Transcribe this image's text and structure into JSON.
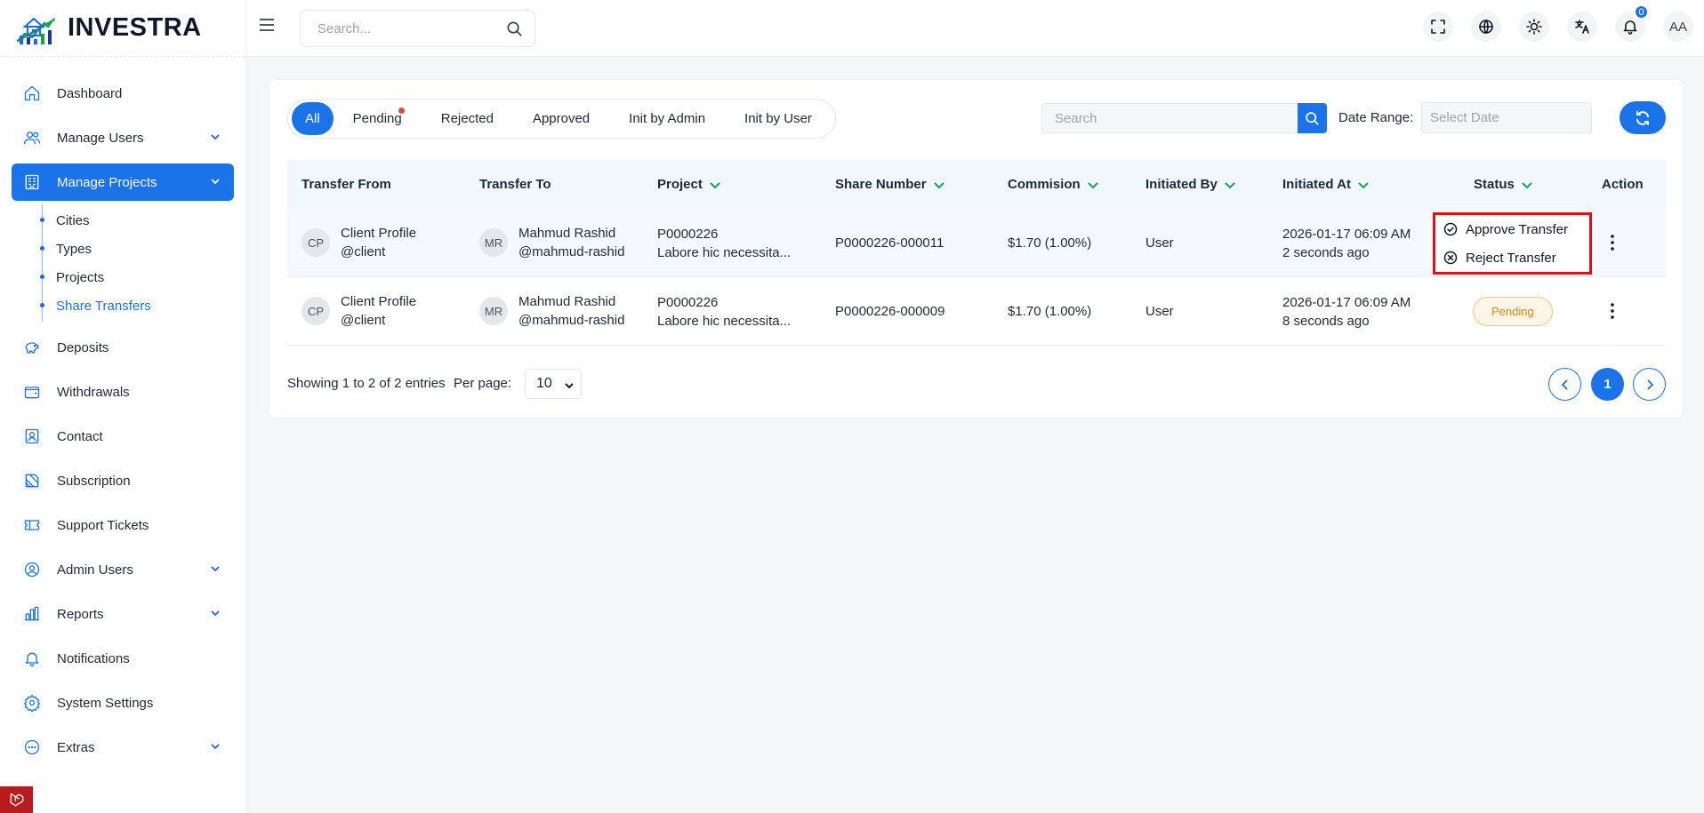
{
  "brand": {
    "name": "INVESTRA"
  },
  "topbar": {
    "search_placeholder": "Search...",
    "notification_count": "0",
    "avatar_initials": "AA"
  },
  "sidebar": {
    "items": [
      {
        "label": "Dashboard",
        "icon": "home-icon"
      },
      {
        "label": "Manage Users",
        "icon": "users-icon",
        "expandable": true
      },
      {
        "label": "Manage Projects",
        "icon": "building-icon",
        "expandable": true,
        "active": true,
        "children": [
          "Cities",
          "Types",
          "Projects",
          "Share Transfers"
        ],
        "active_child": "Share Transfers"
      },
      {
        "label": "Deposits",
        "icon": "piggy-bank-icon"
      },
      {
        "label": "Withdrawals",
        "icon": "wallet-icon"
      },
      {
        "label": "Contact",
        "icon": "contact-icon"
      },
      {
        "label": "Subscription",
        "icon": "subscription-icon"
      },
      {
        "label": "Support Tickets",
        "icon": "ticket-icon"
      },
      {
        "label": "Admin Users",
        "icon": "admin-user-icon",
        "expandable": true
      },
      {
        "label": "Reports",
        "icon": "bar-chart-icon",
        "expandable": true
      },
      {
        "label": "Notifications",
        "icon": "bell-icon"
      },
      {
        "label": "System Settings",
        "icon": "gear-icon"
      },
      {
        "label": "Extras",
        "icon": "dots-circle-icon",
        "expandable": true
      }
    ]
  },
  "filters": {
    "tabs": [
      "All",
      "Pending",
      "Rejected",
      "Approved",
      "Init by Admin",
      "Init by User"
    ],
    "active_tab": "All",
    "search_placeholder": "Search",
    "date_range_label": "Date Range:",
    "date_placeholder": "Select Date"
  },
  "table": {
    "columns": [
      "Transfer From",
      "Transfer To",
      "Project",
      "Share Number",
      "Commision",
      "Initiated By",
      "Initiated At",
      "Status",
      "Action"
    ],
    "rows": [
      {
        "from_initials": "CP",
        "from_name": "Client Profile",
        "from_handle": "@client",
        "to_initials": "MR",
        "to_name": "Mahmud Rashid",
        "to_handle": "@mahmud-rashid",
        "project_code": "P0000226",
        "project_desc": "Labore hic necessita...",
        "share_number": "P0000226-000011",
        "commission": "$1.70 (1.00%)",
        "initiated_by": "User",
        "initiated_at": "2026-01-17 06:09 AM",
        "initiated_ago": "2 seconds ago",
        "status": ""
      },
      {
        "from_initials": "CP",
        "from_name": "Client Profile",
        "from_handle": "@client",
        "to_initials": "MR",
        "to_name": "Mahmud Rashid",
        "to_handle": "@mahmud-rashid",
        "project_code": "P0000226",
        "project_desc": "Labore hic necessita...",
        "share_number": "P0000226-000009",
        "commission": "$1.70 (1.00%)",
        "initiated_by": "User",
        "initiated_at": "2026-01-17 06:09 AM",
        "initiated_ago": "8 seconds ago",
        "status": "Pending"
      }
    ]
  },
  "action_menu": {
    "approve_label": "Approve Transfer",
    "reject_label": "Reject Transfer"
  },
  "pagination": {
    "info": "Showing 1 to 2 of 2 entries",
    "per_page_label": "Per page:",
    "per_page_value": "10",
    "current_page": "1"
  },
  "colors": {
    "accent": "#1a73e8",
    "pending_badge": "#d18a06",
    "sort_icon": "#16a34a",
    "highlight_border": "#e0101a"
  }
}
